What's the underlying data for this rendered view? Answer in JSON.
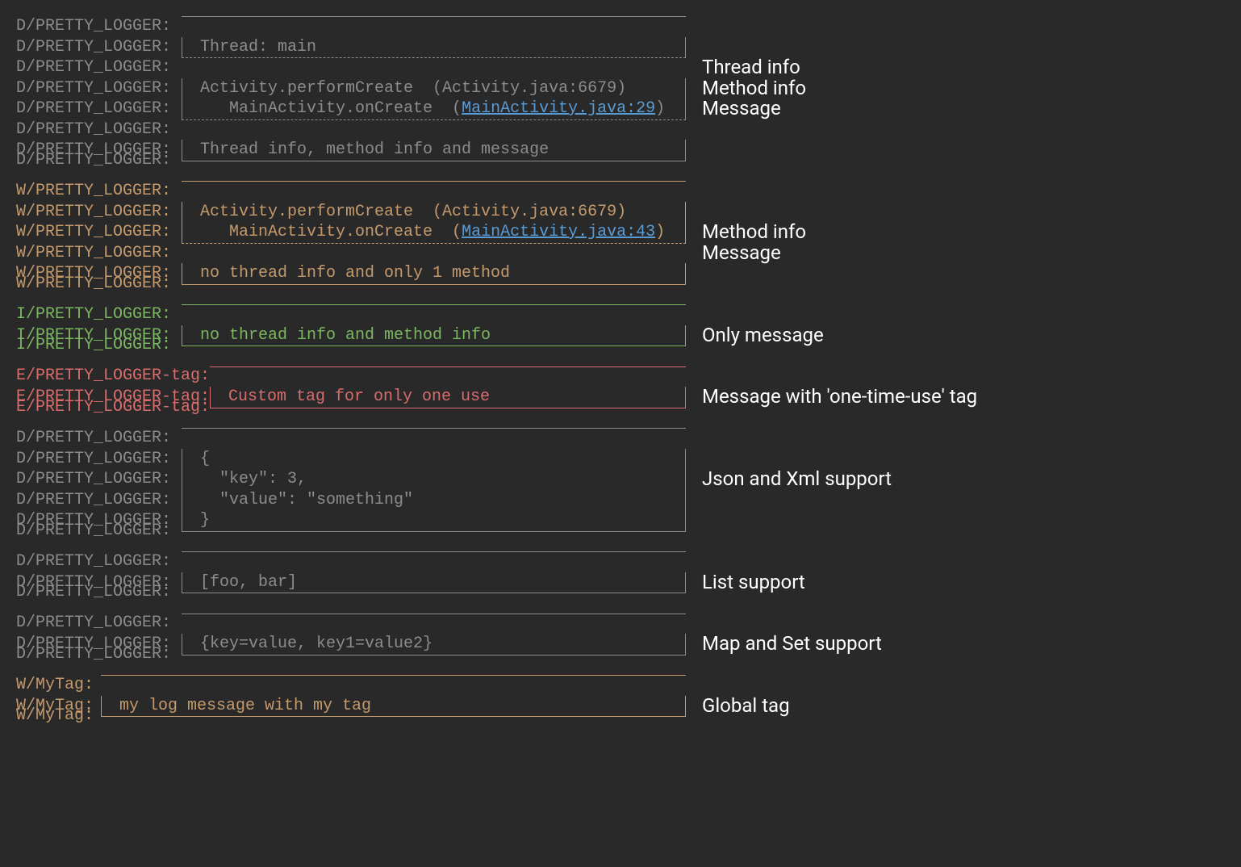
{
  "prefixes": {
    "d": "D/PRETTY_LOGGER:",
    "w": "W/PRETTY_LOGGER:",
    "i": "I/PRETTY_LOGGER:",
    "e": "E/PRETTY_LOGGER-tag:",
    "m": "W/MyTag:"
  },
  "block1": {
    "thread": "Thread: main",
    "method1": "Activity.performCreate  (Activity.java:6679)",
    "method2_pre": "   MainActivity.onCreate  (",
    "method2_link": "MainActivity.java:29",
    "method2_post": ")",
    "msg": "Thread info, method info and message"
  },
  "block2": {
    "method1": "Activity.performCreate  (Activity.java:6679)",
    "method2_pre": "   MainActivity.onCreate  (",
    "method2_link": "MainActivity.java:43",
    "method2_post": ")",
    "msg": "no thread info and only 1 method"
  },
  "block3": {
    "msg": "no thread info and method info"
  },
  "block4": {
    "msg": "Custom tag for only one use"
  },
  "block5": {
    "l1": "{",
    "l2": "  \"key\": 3,",
    "l3": "  \"value\": \"something\"",
    "l4": "}"
  },
  "block6": {
    "msg": "[foo, bar]"
  },
  "block7": {
    "msg": "{key=value, key1=value2}"
  },
  "block8": {
    "msg": "my log message with my tag"
  },
  "annotations": {
    "a1a": "Thread info",
    "a1b": "Method info",
    "a1c": "Message",
    "a2a": "Method info",
    "a2b": "Message",
    "a3": "Only message",
    "a4": "Message with 'one-time-use' tag",
    "a5": "Json and Xml support",
    "a6": "List support",
    "a7": "Map and Set support",
    "a8": "Global tag"
  }
}
